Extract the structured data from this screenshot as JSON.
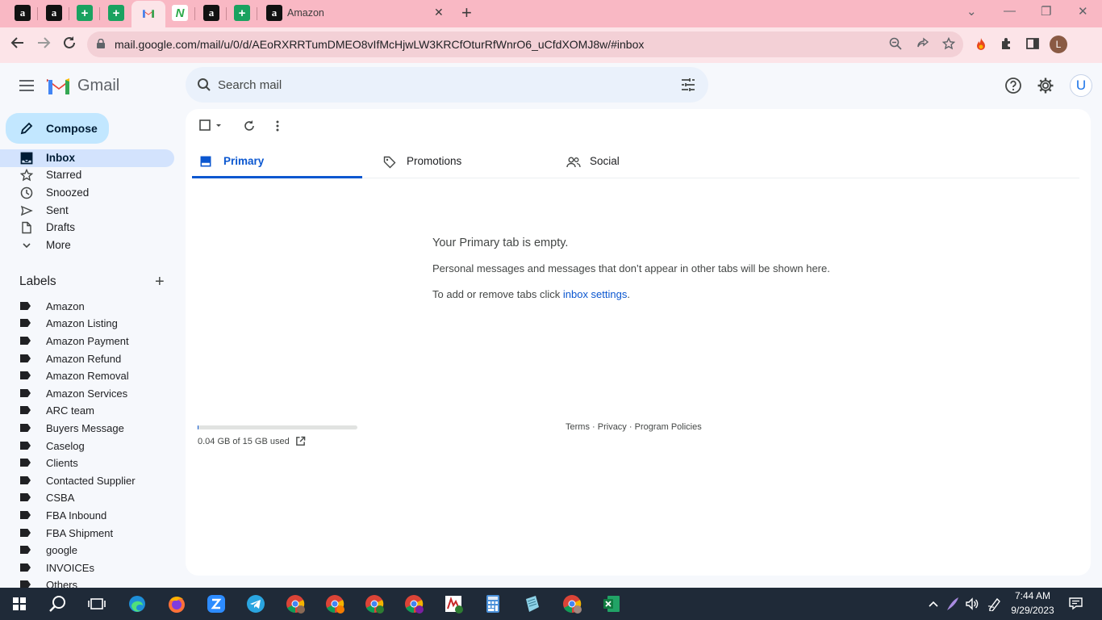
{
  "browser": {
    "active_tab_title": "Amazon",
    "tab_favicons": [
      "amazon-icon",
      "amazon-icon",
      "sheets-icon",
      "sheets-icon",
      "gmail-icon",
      "n-icon",
      "amazon-icon",
      "sheets-icon",
      "amazon-icon"
    ],
    "url": "mail.google.com/mail/u/0/d/AEoRXRRTumDMEO8vIfMcHjwLW3KRCfOturRfWnrO6_uCfdXOMJ8w/#inbox",
    "profile_initial": "L"
  },
  "gmail": {
    "brand": "Gmail",
    "search_placeholder": "Search mail",
    "avatar_initial": "U",
    "compose_label": "Compose",
    "nav": {
      "inbox": "Inbox",
      "starred": "Starred",
      "snoozed": "Snoozed",
      "sent": "Sent",
      "drafts": "Drafts",
      "more": "More"
    },
    "labels_title": "Labels",
    "labels": [
      "Amazon",
      "Amazon Listing",
      "Amazon Payment",
      "Amazon Refund",
      "Amazon Removal",
      "Amazon Services",
      "ARC team",
      "Buyers Message",
      "Caselog",
      "Clients",
      "Contacted Supplier",
      "CSBA",
      "FBA Inbound",
      "FBA Shipment",
      "google",
      "INVOICEs",
      "Others"
    ],
    "tabs": {
      "primary": "Primary",
      "promotions": "Promotions",
      "social": "Social"
    },
    "empty": {
      "title": "Your Primary tab is empty.",
      "description": "Personal messages and messages that don’t appear in other tabs will be shown here.",
      "tip_prefix": "To add or remove tabs click ",
      "tip_link": "inbox settings",
      "tip_suffix": "."
    },
    "storage": {
      "text": "0.04 GB of 15 GB used",
      "used_fraction": 0.003
    },
    "footer": {
      "terms": "Terms",
      "privacy": "Privacy",
      "policies": "Program Policies",
      "sep": "·"
    }
  },
  "taskbar": {
    "time": "7:44 AM",
    "date": "9/29/2023"
  },
  "colors": {
    "tab_strip": "#f9b8c4",
    "toolbar": "#fce4e8",
    "accent": "#0b57d0",
    "compose": "#c2e7ff"
  }
}
